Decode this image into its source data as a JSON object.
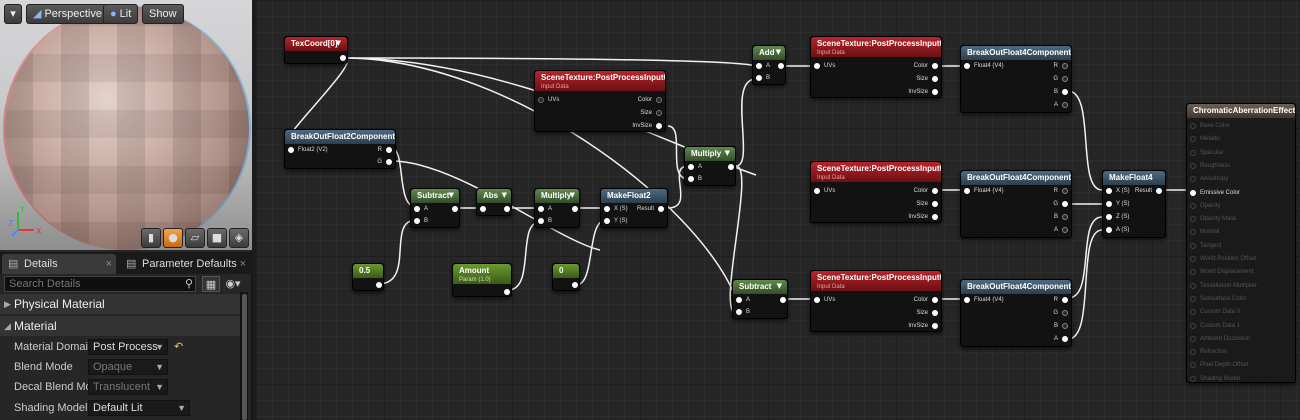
{
  "viewport": {
    "perspective_label": "Perspective",
    "lit_label": "Lit",
    "show_label": "Show",
    "axis_labels": [
      "X",
      "Y",
      "Z"
    ],
    "dropdown_icon": "chevron-down-icon"
  },
  "details": {
    "tab_details": "Details",
    "tab_params": "Parameter Defaults",
    "search_placeholder": "Search Details",
    "cat_physical": "Physical Material",
    "cat_material": "Material",
    "props": [
      {
        "label": "Material Domain",
        "value": "Post Process"
      },
      {
        "label": "Blend Mode",
        "value": "Opaque"
      },
      {
        "label": "Decal Blend Mode",
        "value": "Translucent"
      },
      {
        "label": "Shading Model",
        "value": "Default Lit"
      }
    ]
  },
  "graph": {
    "texcoord": {
      "title": "TexCoord[0]"
    },
    "bo2": {
      "title": "BreakOutFloat2Components",
      "in": "Float2 (V2)",
      "outs": [
        "R",
        "G"
      ]
    },
    "const_a": {
      "value": "0.5"
    },
    "amount": {
      "title": "Amount",
      "sub": "Param (1.0)"
    },
    "const_b": {
      "value": "0"
    },
    "subtract1": {
      "title": "Subtract",
      "ins": [
        "A",
        "B"
      ]
    },
    "abs": {
      "title": "Abs"
    },
    "multiply1": {
      "title": "Multiply",
      "ins": [
        "A",
        "B"
      ]
    },
    "makefloat2": {
      "title": "MakeFloat2",
      "ins": [
        "X (S)",
        "Y (S)"
      ],
      "out": "Result"
    },
    "st_mid": {
      "title": "SceneTexture:PostProcessInput0",
      "sub": "Input Data",
      "in": "UVs",
      "outs": [
        "Color",
        "Size",
        "InvSize"
      ]
    },
    "multiply2": {
      "title": "Multiply",
      "ins": [
        "A",
        "B"
      ]
    },
    "add": {
      "title": "Add",
      "ins": [
        "A",
        "B"
      ]
    },
    "subtract2": {
      "title": "Subtract",
      "ins": [
        "A",
        "B"
      ]
    },
    "st1": {
      "title": "SceneTexture:PostProcessInput0",
      "sub": "Input Data",
      "in": "UVs",
      "outs": [
        "Color",
        "Size",
        "InvSize"
      ]
    },
    "st2": {
      "title": "SceneTexture:PostProcessInput0",
      "sub": "Input Data",
      "in": "UVs",
      "outs": [
        "Color",
        "Size",
        "InvSize"
      ]
    },
    "st3": {
      "title": "SceneTexture:PostProcessInput0",
      "sub": "Input Data",
      "in": "UVs",
      "outs": [
        "Color",
        "Size",
        "InvSize"
      ]
    },
    "bo4a": {
      "title": "BreakOutFloat4Components",
      "in": "Float4 (V4)",
      "outs": [
        "R",
        "G",
        "B",
        "A"
      ]
    },
    "bo4b": {
      "title": "BreakOutFloat4Components",
      "in": "Float4 (V4)",
      "outs": [
        "R",
        "G",
        "B",
        "A"
      ]
    },
    "bo4c": {
      "title": "BreakOutFloat4Components",
      "in": "Float4 (V4)",
      "outs": [
        "R",
        "G",
        "B",
        "A"
      ]
    },
    "makefloat4": {
      "title": "MakeFloat4",
      "ins": [
        "X (S)",
        "Y (S)",
        "Z (S)",
        "A (S)"
      ],
      "out": "Result"
    },
    "material": {
      "title": "ChromaticAberrationEffect",
      "pins": [
        "Base Color",
        "Metallic",
        "Specular",
        "Roughness",
        "Anisotropy",
        "Emissive Color",
        "Opacity",
        "Opacity Mask",
        "Normal",
        "Tangent",
        "World Position Offset",
        "World Displacement",
        "Tessellation Multiplier",
        "Subsurface Color",
        "Custom Data 0",
        "Custom Data 1",
        "Ambient Occlusion",
        "Refraction",
        "Pixel Depth Offset",
        "Shading Model"
      ],
      "active_pin": "Emissive Color"
    }
  },
  "colors": {
    "scene_texture": "#b8252b",
    "math": "#5f8a4c",
    "struct": "#4d6a82",
    "result": "#6c5e51",
    "constant": "#6b9a2f",
    "selected_shape": "#f2a44a"
  }
}
